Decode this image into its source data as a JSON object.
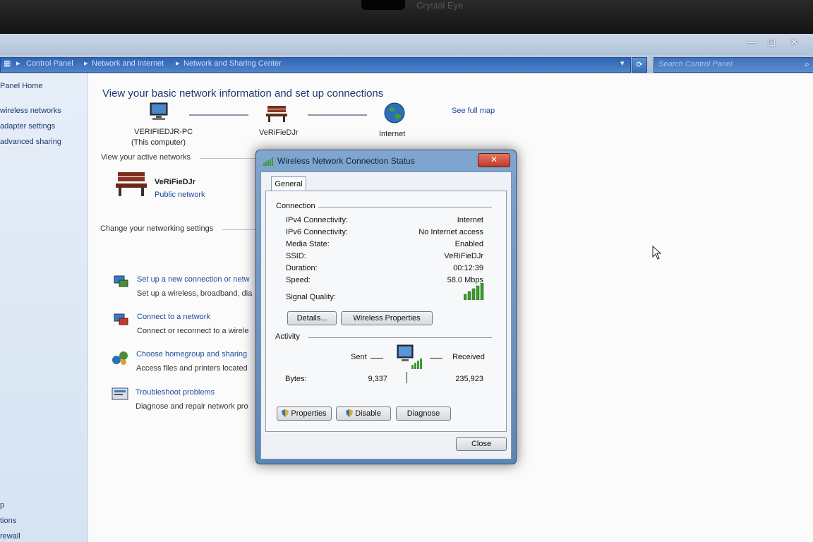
{
  "bezel": {
    "text": "Crystal Eye"
  },
  "window": {
    "controls": {
      "min": "—",
      "max": "◻",
      "close": "✕"
    }
  },
  "address": {
    "crumbs": [
      "Control Panel",
      "Network and Internet",
      "Network and Sharing Center"
    ],
    "search_placeholder": "Search Control Panel"
  },
  "sidebar": {
    "items": [
      "Panel Home",
      "wireless networks",
      "adapter settings",
      "advanced sharing"
    ],
    "bottom": [
      "p",
      "tions",
      "rewall"
    ]
  },
  "main": {
    "title": "View your basic network information and set up connections",
    "map": {
      "computer_name": "VERIFIEDJR-PC",
      "computer_sub": "(This computer)",
      "network_name": "VeRiFieDJr",
      "internet": "Internet",
      "see_full_map": "See full map"
    },
    "active_heading": "View your active networks",
    "active_network": {
      "name": "VeRiFieDJr",
      "type": "Public network"
    },
    "settings_heading": "Change your networking settings",
    "tasks": [
      {
        "link": "Set up a new connection or netw",
        "desc": "Set up a wireless, broadband, dia"
      },
      {
        "link": "Connect to a network",
        "desc": "Connect or reconnect to a wirele"
      },
      {
        "link": "Choose homegroup and sharing",
        "desc": "Access files and printers located"
      },
      {
        "link": "Troubleshoot problems",
        "desc": "Diagnose and repair network pro"
      }
    ]
  },
  "dialog": {
    "title": "Wireless Network Connection Status",
    "close": "✕",
    "tab": "General",
    "connection_heading": "Connection",
    "rows": [
      {
        "label": "IPv4 Connectivity:",
        "value": "Internet"
      },
      {
        "label": "IPv6 Connectivity:",
        "value": "No Internet access"
      },
      {
        "label": "Media State:",
        "value": "Enabled"
      },
      {
        "label": "SSID:",
        "value": "VeRiFieDJr"
      },
      {
        "label": "Duration:",
        "value": "00:12:39"
      },
      {
        "label": "Speed:",
        "value": "58.0 Mbps"
      }
    ],
    "signal_label": "Signal Quality:",
    "signal_bars": 5,
    "details_button": "Details...",
    "wireless_props_button": "Wireless Properties",
    "activity_heading": "Activity",
    "sent_label": "Sent",
    "received_label": "Received",
    "bytes_label": "Bytes:",
    "bytes_sent": "9,337",
    "bytes_received": "235,923",
    "properties_button": "Properties",
    "disable_button": "Disable",
    "diagnose_button": "Diagnose",
    "close_button": "Close"
  },
  "colors": {
    "link": "#1f4a9b",
    "heading": "#1e3a6e",
    "accent_close": "#c2392a"
  }
}
